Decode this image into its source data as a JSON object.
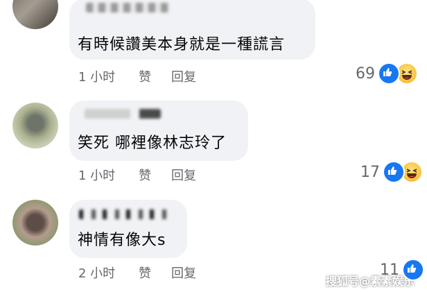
{
  "comments": [
    {
      "text": "有時候讚美本身就是一種謊言",
      "time": "1 小时",
      "like_label": "赞",
      "reply_label": "回复",
      "reaction_count": "69",
      "reactions": [
        "like-icon",
        "haha-icon"
      ]
    },
    {
      "text": "笑死 哪裡像林志玲了",
      "time": "1 小时",
      "like_label": "赞",
      "reply_label": "回复",
      "reaction_count": "17",
      "reactions": [
        "like-icon",
        "haha-icon"
      ]
    },
    {
      "text": "神情有像大s",
      "time": "2 小时",
      "like_label": "赞",
      "reply_label": "回复",
      "reaction_count": "11",
      "reactions": [
        "like-icon"
      ]
    }
  ],
  "watermark": "搜狐号@素素娱乐",
  "colors": {
    "bubble": "#f0f2f5",
    "meta": "#65676b",
    "like": "#1877f2",
    "haha": "#f7b125"
  }
}
